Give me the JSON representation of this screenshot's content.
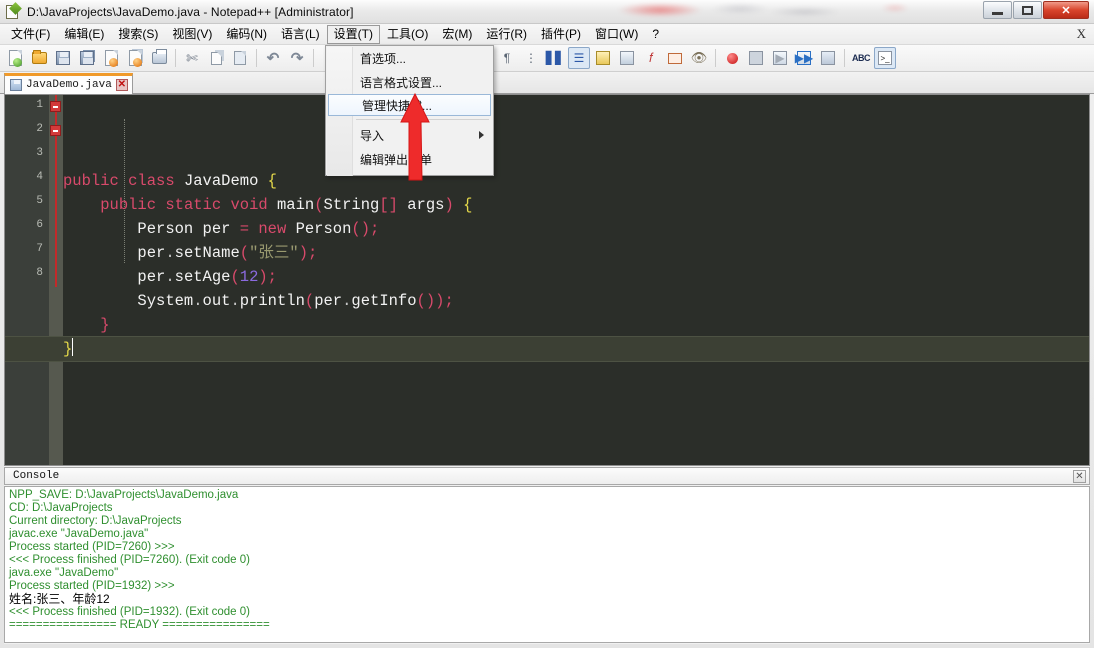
{
  "window": {
    "title": "D:\\JavaProjects\\JavaDemo.java - Notepad++ [Administrator]",
    "icon": "notepad-plus-plus-icon",
    "controls": {
      "minimize": "–",
      "maximize": "□",
      "close": "✕"
    }
  },
  "menubar": {
    "items": [
      {
        "label": "文件(F)",
        "name": "menu-file",
        "open": false
      },
      {
        "label": "编辑(E)",
        "name": "menu-edit",
        "open": false
      },
      {
        "label": "搜索(S)",
        "name": "menu-search",
        "open": false
      },
      {
        "label": "视图(V)",
        "name": "menu-view",
        "open": false
      },
      {
        "label": "编码(N)",
        "name": "menu-encoding",
        "open": false
      },
      {
        "label": "语言(L)",
        "name": "menu-language",
        "open": false
      },
      {
        "label": "设置(T)",
        "name": "menu-settings",
        "open": true
      },
      {
        "label": "工具(O)",
        "name": "menu-tools",
        "open": false
      },
      {
        "label": "宏(M)",
        "name": "menu-macro",
        "open": false
      },
      {
        "label": "运行(R)",
        "name": "menu-run",
        "open": false
      },
      {
        "label": "插件(P)",
        "name": "menu-plugins",
        "open": false
      },
      {
        "label": "窗口(W)",
        "name": "menu-window",
        "open": false
      },
      {
        "label": "?",
        "name": "menu-help",
        "open": false
      }
    ],
    "close_document": "X"
  },
  "settings_menu": {
    "items": [
      {
        "label": "首选项...",
        "name": "menu-item-preferences",
        "highlighted": false,
        "submenu": false
      },
      {
        "label": "语言格式设置...",
        "name": "menu-item-style-configurator",
        "highlighted": false,
        "submenu": false
      },
      {
        "label": "管理快捷键...",
        "name": "menu-item-shortcut-mapper",
        "highlighted": true,
        "submenu": false
      },
      {
        "label": "导入",
        "name": "menu-item-import",
        "highlighted": false,
        "submenu": true
      },
      {
        "label": "编辑弹出菜单",
        "name": "menu-item-edit-popup-context-menu",
        "highlighted": false,
        "submenu": false
      }
    ]
  },
  "toolbar": {
    "icons": [
      "new-file-icon",
      "open-file-icon",
      "save-icon",
      "save-all-icon",
      "close-file-icon",
      "close-all-files-icon",
      "print-icon",
      "cut-icon",
      "copy-icon",
      "paste-icon",
      "undo-icon",
      "redo-icon",
      "find-icon",
      "replace-icon",
      "zoom-in-icon",
      "zoom-out-icon",
      "sync-vertical-icon",
      "sync-horizontal-icon",
      "word-wrap-icon",
      "show-all-chars-icon",
      "indent-guide-icon",
      "ui-hint-icon",
      "show-symbol-icon",
      "document-map-icon",
      "function-list-icon",
      "folder-as-workspace-icon",
      "monitoring-icon",
      "record-macro-icon",
      "stop-recording-icon",
      "playback-icon",
      "run-macro-multiple-icon",
      "save-macro-icon",
      "spellcheck-icon",
      "run-console-icon"
    ]
  },
  "tab": {
    "label": "JavaDemo.java",
    "icon": "saved-file-icon",
    "close": "✕"
  },
  "editor": {
    "line_numbers": [
      "1",
      "2",
      "3",
      "4",
      "5",
      "6",
      "7",
      "8"
    ],
    "current_line": 8,
    "lines": [
      {
        "n": 1,
        "tokens": [
          {
            "t": "public",
            "c": "kw"
          },
          {
            "t": " ",
            "c": "id"
          },
          {
            "t": "class",
            "c": "kw"
          },
          {
            "t": " ",
            "c": "id"
          },
          {
            "t": "JavaDemo",
            "c": "id"
          },
          {
            "t": " {",
            "c": "brc"
          }
        ]
      },
      {
        "n": 2,
        "tokens": [
          {
            "t": "    ",
            "c": "id"
          },
          {
            "t": "public",
            "c": "kw"
          },
          {
            "t": " ",
            "c": "id"
          },
          {
            "t": "static",
            "c": "kw"
          },
          {
            "t": " ",
            "c": "id"
          },
          {
            "t": "void",
            "c": "kw"
          },
          {
            "t": " main",
            "c": "id"
          },
          {
            "t": "(",
            "c": "pun"
          },
          {
            "t": "String",
            "c": "id"
          },
          {
            "t": "[",
            "c": "pun"
          },
          {
            "t": "]",
            "c": "pun"
          },
          {
            "t": " args",
            "c": "id"
          },
          {
            "t": ")",
            "c": "pun"
          },
          {
            "t": " {",
            "c": "brc"
          }
        ]
      },
      {
        "n": 3,
        "tokens": [
          {
            "t": "        ",
            "c": "id"
          },
          {
            "t": "Person per ",
            "c": "id"
          },
          {
            "t": "= ",
            "c": "pun"
          },
          {
            "t": "new",
            "c": "kw"
          },
          {
            "t": " Person",
            "c": "id"
          },
          {
            "t": "();",
            "c": "pun"
          }
        ]
      },
      {
        "n": 4,
        "tokens": [
          {
            "t": "        ",
            "c": "id"
          },
          {
            "t": "per",
            "c": "id"
          },
          {
            "t": ".",
            "c": "dotop"
          },
          {
            "t": "setName",
            "c": "id"
          },
          {
            "t": "(",
            "c": "pun"
          },
          {
            "t": "\"张三\"",
            "c": "str"
          },
          {
            "t": ");",
            "c": "pun"
          }
        ]
      },
      {
        "n": 5,
        "tokens": [
          {
            "t": "        ",
            "c": "id"
          },
          {
            "t": "per",
            "c": "id"
          },
          {
            "t": ".",
            "c": "dotop"
          },
          {
            "t": "setAge",
            "c": "id"
          },
          {
            "t": "(",
            "c": "pun"
          },
          {
            "t": "12",
            "c": "num"
          },
          {
            "t": ");",
            "c": "pun"
          }
        ]
      },
      {
        "n": 6,
        "tokens": [
          {
            "t": "        ",
            "c": "id"
          },
          {
            "t": "System",
            "c": "id"
          },
          {
            "t": ".",
            "c": "dotop"
          },
          {
            "t": "out",
            "c": "id"
          },
          {
            "t": ".",
            "c": "dotop"
          },
          {
            "t": "println",
            "c": "id"
          },
          {
            "t": "(",
            "c": "pun"
          },
          {
            "t": "per",
            "c": "id"
          },
          {
            "t": ".",
            "c": "dotop"
          },
          {
            "t": "getInfo",
            "c": "id"
          },
          {
            "t": "());",
            "c": "pun"
          }
        ]
      },
      {
        "n": 7,
        "tokens": [
          {
            "t": "    ",
            "c": "id"
          },
          {
            "t": "}",
            "c": "pun"
          }
        ]
      },
      {
        "n": 8,
        "tokens": [
          {
            "t": "}",
            "c": "brc"
          }
        ]
      }
    ]
  },
  "console": {
    "title": "Console",
    "close": "✕",
    "lines": [
      {
        "text": "NPP_SAVE: D:\\JavaProjects\\JavaDemo.java",
        "color": "green"
      },
      {
        "text": "CD: D:\\JavaProjects",
        "color": "green"
      },
      {
        "text": "Current directory: D:\\JavaProjects",
        "color": "green"
      },
      {
        "text": "javac.exe \"JavaDemo.java\"",
        "color": "green"
      },
      {
        "text": "Process started (PID=7260) >>>",
        "color": "green"
      },
      {
        "text": "<<< Process finished (PID=7260). (Exit code 0)",
        "color": "green"
      },
      {
        "text": "java.exe \"JavaDemo\"",
        "color": "green"
      },
      {
        "text": "Process started (PID=1932) >>>",
        "color": "green"
      },
      {
        "text": "姓名:张三、年龄12",
        "color": "black"
      },
      {
        "text": "<<< Process finished (PID=1932). (Exit code 0)",
        "color": "green"
      },
      {
        "text": "================ READY ================",
        "color": "green"
      }
    ]
  },
  "annotation": {
    "arrow": "red-up-arrow",
    "color": "#ee2b2b",
    "points_to": "管理快捷键..."
  },
  "colors": {
    "accent_tab": "#f09a2a",
    "editor_bg": "#2b2e29",
    "gutter_bg": "#3b3f3a",
    "fold_red": "#c22a2a",
    "keyword": "#d84a6b",
    "string": "#9a9a70",
    "number": "#8b6adf",
    "brace": "#e4d84a",
    "console_green": "#2f8f2f",
    "close_button": "#d9452c"
  }
}
